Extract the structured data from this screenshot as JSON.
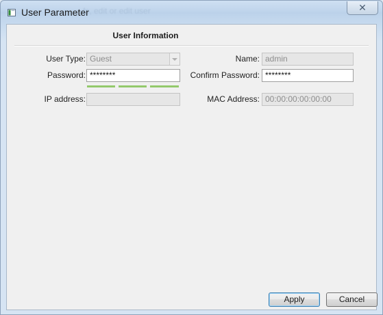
{
  "window": {
    "title": "User Parameter",
    "background_title_text": "fs, edit or edit user"
  },
  "section": {
    "title": "User Information"
  },
  "form": {
    "user_type": {
      "label": "User Type:",
      "value": "Guest",
      "disabled": true
    },
    "name": {
      "label": "Name:",
      "value": "admin",
      "disabled": true
    },
    "password": {
      "label": "Password:",
      "value": "********"
    },
    "confirm_password": {
      "label": "Confirm Password:",
      "value": "********"
    },
    "password_strength": {
      "segments_filled": 3,
      "segments_total": 3,
      "color": "#93c96b"
    },
    "ip_address": {
      "label": "IP address:",
      "value": "",
      "disabled": true
    },
    "mac_address": {
      "label": "MAC Address:",
      "value": "00:00:00:00:00:00",
      "disabled": true
    }
  },
  "buttons": {
    "apply": "Apply",
    "cancel": "Cancel"
  },
  "icons": {
    "app": "window-app-icon",
    "close": "close-icon",
    "dropdown": "chevron-down-icon"
  }
}
